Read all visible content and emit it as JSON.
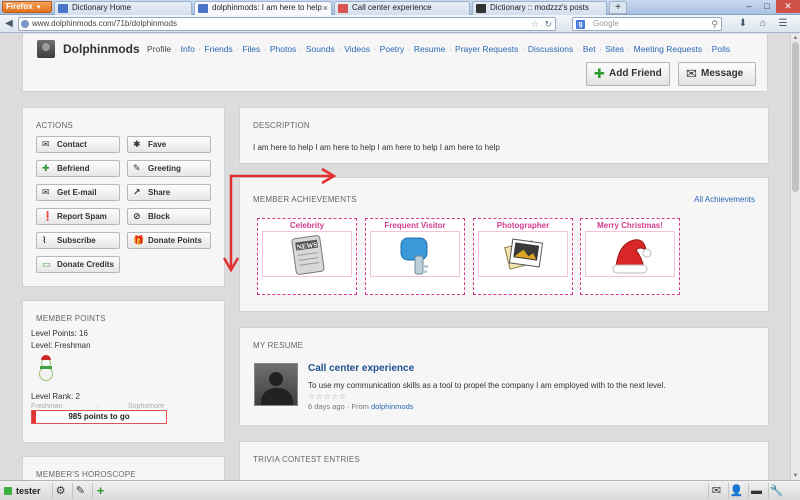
{
  "browser": {
    "menu_label": "Firefox",
    "tabs": [
      {
        "title": "Dictionary Home",
        "active": false
      },
      {
        "title": "dolphinmods: I am here to help",
        "active": true
      },
      {
        "title": "Call center experience",
        "active": false
      },
      {
        "title": "Dictionary :: modzzz's posts",
        "active": false
      }
    ],
    "url": "www.dolphinmods.com/71b/dolphinmods",
    "search_placeholder": "Google",
    "search_engine_letter": "g"
  },
  "header": {
    "name": "Dolphinmods",
    "nav": [
      "Profile",
      "Info",
      "Friends",
      "Files",
      "Photos",
      "Sounds",
      "Videos",
      "Poetry",
      "Resume",
      "Prayer Requests",
      "Discussions",
      "Bet",
      "Sites",
      "Meeting Requests",
      "Polls"
    ],
    "add_friend": "Add Friend",
    "message": "Message"
  },
  "actions": {
    "title": "ACTIONS",
    "buttons": [
      {
        "label": "Contact",
        "icon": "envelope-icon"
      },
      {
        "label": "Fave",
        "icon": "asterisk-icon"
      },
      {
        "label": "Befriend",
        "icon": "plus-icon"
      },
      {
        "label": "Greeting",
        "icon": "pencil-icon"
      },
      {
        "label": "Get E-mail",
        "icon": "email-icon"
      },
      {
        "label": "Share",
        "icon": "share-icon"
      },
      {
        "label": "Report Spam",
        "icon": "exclamation-icon"
      },
      {
        "label": "Block",
        "icon": "block-icon"
      },
      {
        "label": "Subscribe",
        "icon": "paperclip-icon"
      },
      {
        "label": "Donate Points",
        "icon": "gift-icon"
      },
      {
        "label": "Donate Credits",
        "icon": "money-icon"
      }
    ]
  },
  "points": {
    "title": "MEMBER POINTS",
    "level_points": "Level Points: 16",
    "level": "Level: Freshman",
    "level_rank": "Level Rank: 2",
    "from_level": "Freshman",
    "to_level": "Sophomore",
    "progress_fraction": 0.03,
    "progress_text": "985 points to go"
  },
  "horoscope": {
    "title": "MEMBER'S HOROSCOPE"
  },
  "description": {
    "title": "DESCRIPTION",
    "text": "I am here to help I am here to help I am here to help I am here to help"
  },
  "achievements": {
    "title": "MEMBER ACHIEVEMENTS",
    "all_link": "All Achievements",
    "badges": [
      {
        "title": "Celebrity",
        "icon": "newspaper-icon"
      },
      {
        "title": "Frequent Visitor",
        "icon": "key-icon"
      },
      {
        "title": "Photographer",
        "icon": "photos-icon"
      },
      {
        "title": "Merry Christmas!",
        "icon": "santa-hat-icon"
      }
    ]
  },
  "resume": {
    "title": "MY RESUME",
    "entry_title": "Call center experience",
    "entry_text": "To use my communication skills as a tool to propel the company I am employed with to the next level.",
    "stars": "☆☆☆☆☆",
    "time": "6 days ago",
    "from_label": "From",
    "author": "dolphinmods"
  },
  "trivia": {
    "title": "TRIVIA CONTEST ENTRIES"
  },
  "bottombar": {
    "user": "tester"
  },
  "colors": {
    "link": "#2a68b5",
    "achievement_pink": "#d43b8c",
    "progress_red": "#e03434",
    "annotation_red": "#e03030"
  }
}
